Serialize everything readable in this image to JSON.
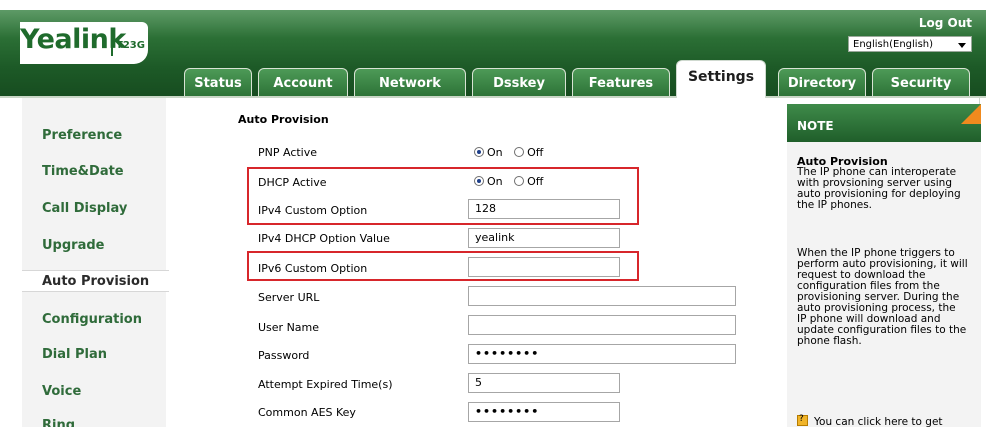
{
  "header": {
    "logo_brand": "Yealink",
    "logo_model": "T23G",
    "logout_label": "Log Out",
    "language_selected": "English(English)"
  },
  "tabs": [
    {
      "label": "Status"
    },
    {
      "label": "Account"
    },
    {
      "label": "Network"
    },
    {
      "label": "Dsskey"
    },
    {
      "label": "Features"
    },
    {
      "label": "Settings"
    },
    {
      "label": "Directory"
    },
    {
      "label": "Security"
    }
  ],
  "active_tab": "Settings",
  "sidebar": {
    "items": [
      {
        "label": "Preference"
      },
      {
        "label": "Time&Date"
      },
      {
        "label": "Call Display"
      },
      {
        "label": "Upgrade"
      },
      {
        "label": "Auto Provision"
      },
      {
        "label": "Configuration"
      },
      {
        "label": "Dial Plan"
      },
      {
        "label": "Voice"
      },
      {
        "label": "Ring"
      }
    ],
    "active": "Auto Provision"
  },
  "form": {
    "section_title": "Auto Provision",
    "pnp_active": {
      "label": "PNP Active",
      "on": "On",
      "off": "Off",
      "value": "On"
    },
    "dhcp_active": {
      "label": "DHCP Active",
      "on": "On",
      "off": "Off",
      "value": "On"
    },
    "ipv4_custom_option": {
      "label": "IPv4 Custom Option",
      "value": "128"
    },
    "ipv4_dhcp_option_value": {
      "label": "IPv4 DHCP Option Value",
      "value": "yealink"
    },
    "ipv6_custom_option": {
      "label": "IPv6 Custom Option",
      "value": ""
    },
    "server_url": {
      "label": "Server URL",
      "value": ""
    },
    "user_name": {
      "label": "User Name",
      "value": ""
    },
    "password": {
      "label": "Password",
      "value": "••••••••"
    },
    "attempt_expired_time": {
      "label": "Attempt Expired Time(s)",
      "value": "5"
    },
    "common_aes_key": {
      "label": "Common AES Key",
      "value": "••••••••"
    }
  },
  "note": {
    "header": "NOTE",
    "title": "Auto Provision",
    "lines_1": [
      "The IP phone can interoperate",
      "with provsioning server using",
      "auto provisioning for deploying",
      "the IP phones."
    ],
    "lines_2": [
      "When the IP phone triggers to",
      "perform auto provisioning, it will",
      "request to download the",
      "configuration files from the",
      "provisioning server. During the",
      "auto provisioning process, the",
      "IP phone will download and",
      "update configuration files to the",
      "phone flash."
    ],
    "footer": "You can click here to get"
  },
  "colors": {
    "brand_green": "#2b6f35",
    "highlight_red": "#d7262b",
    "note_corner_orange": "#f08a1e"
  }
}
